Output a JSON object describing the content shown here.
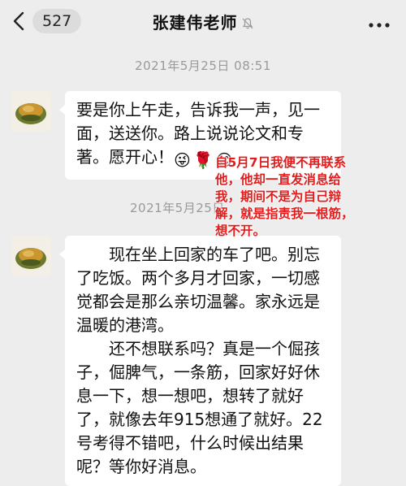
{
  "header": {
    "back_count": "527",
    "title": "张建伟老师",
    "icons": {
      "back": "chevron-left-icon",
      "mute": "bell-muted-icon",
      "more": "more-dots-icon"
    }
  },
  "messages": [
    {
      "timestamp": "2021年5月25日 08:51",
      "lines": [
        "要是你上午走，告诉我一声，见一",
        "面，送送你。路上说说论文和专",
        "著。愿开心！"
      ],
      "emojis": [
        "😜",
        "🌹",
        "😊"
      ]
    },
    {
      "timestamp": "2021年5月25日",
      "paragraphs": [
        "现在坐上回家的车了吧。别忘了吃饭。两个多月才回家，一切感觉都会是那么亲切温馨。家永远是温暖的港湾。",
        "还不想联系吗？真是一个倔孩子，倔脾气，一条筋，回家好好休息一下，想一想吧，想转了就好了，就像去年915想通了就好。22号考得不错吧，什么时候出结果呢？等你好消息。"
      ]
    }
  ],
  "annotation": {
    "lines": [
      "自5月7日我便不再联系",
      "他，他却一直发消息给",
      "我，期间不是为自己辩",
      "解，就是指责我一根筋，",
      "想不开。"
    ],
    "color": "#e21c1c"
  },
  "colors": {
    "background": "#ededed",
    "bubble": "#ffffff",
    "timestamp": "#9a9a9a"
  }
}
